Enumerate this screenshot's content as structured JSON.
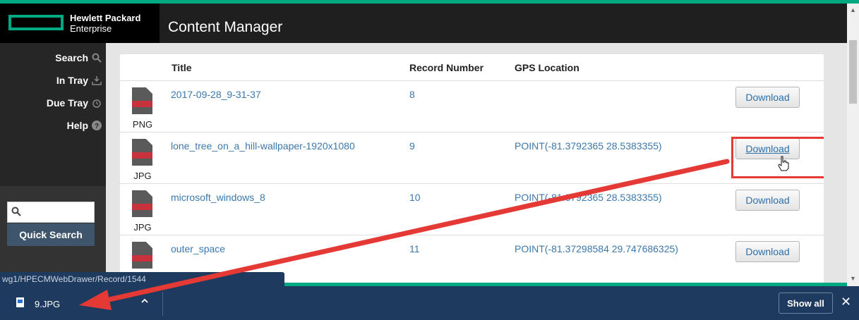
{
  "colors": {
    "accent_green": "#01a982",
    "link_blue": "#3b78ad",
    "annotation_red": "#e53935",
    "download_bar": "#1e3a5f"
  },
  "brand": {
    "line1": "Hewlett Packard",
    "line2": "Enterprise",
    "logo_icon": "hpe-rectangle-logo"
  },
  "app": {
    "title": "Content Manager"
  },
  "sidebar": {
    "items": [
      {
        "label": "Search",
        "icon": "search-icon"
      },
      {
        "label": "In Tray",
        "icon": "download-tray-icon"
      },
      {
        "label": "Due Tray",
        "icon": "alarm-clock-icon"
      },
      {
        "label": "Help",
        "icon": "help-icon"
      }
    ],
    "quick_search": {
      "placeholder": "",
      "button_label": "Quick Search"
    }
  },
  "table": {
    "columns": [
      "Title",
      "Record Number",
      "GPS Location"
    ],
    "rows": [
      {
        "ext": "PNG",
        "title": "2017-09-28_9-31-37",
        "record": "8",
        "gps": "",
        "button": "Download"
      },
      {
        "ext": "JPG",
        "title": "lone_tree_on_a_hill-wallpaper-1920x1080",
        "record": "9",
        "gps": "POINT(-81.3792365 28.5383355)",
        "button": "Download"
      },
      {
        "ext": "JPG",
        "title": "microsoft_windows_8",
        "record": "10",
        "gps": "POINT(-81.3792365 28.5383355)",
        "button": "Download"
      },
      {
        "ext": "",
        "title": "outer_space",
        "record": "11",
        "gps": "POINT(-81.37298584 29.747686325)",
        "button": "Download"
      }
    ]
  },
  "status_bar": {
    "url": "wg1/HPECMWebDrawer/Record/1544"
  },
  "download_bar": {
    "file_name": "9.JPG",
    "show_all": "Show all"
  }
}
